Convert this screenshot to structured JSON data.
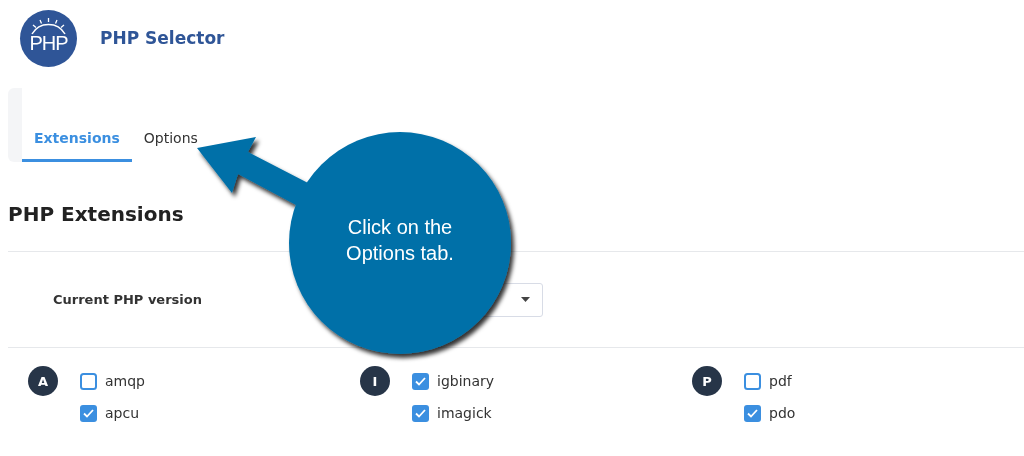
{
  "header": {
    "logo_text": "PHP",
    "title": "PHP Selector"
  },
  "tabs": [
    {
      "label": "Extensions",
      "selected": true
    },
    {
      "label": "Options",
      "selected": false
    }
  ],
  "section_title": "PHP Extensions",
  "version_field": {
    "label": "Current PHP version"
  },
  "extension_groups": [
    {
      "letter": "A",
      "items": [
        {
          "name": "amqp",
          "checked": false
        },
        {
          "name": "apcu",
          "checked": true
        }
      ]
    },
    {
      "letter": "I",
      "items": [
        {
          "name": "igbinary",
          "checked": true
        },
        {
          "name": "imagick",
          "checked": true
        }
      ]
    },
    {
      "letter": "P",
      "items": [
        {
          "name": "pdf",
          "checked": false
        },
        {
          "name": "pdo",
          "checked": true
        }
      ]
    }
  ],
  "callout": {
    "text": "Click on the Options tab."
  }
}
